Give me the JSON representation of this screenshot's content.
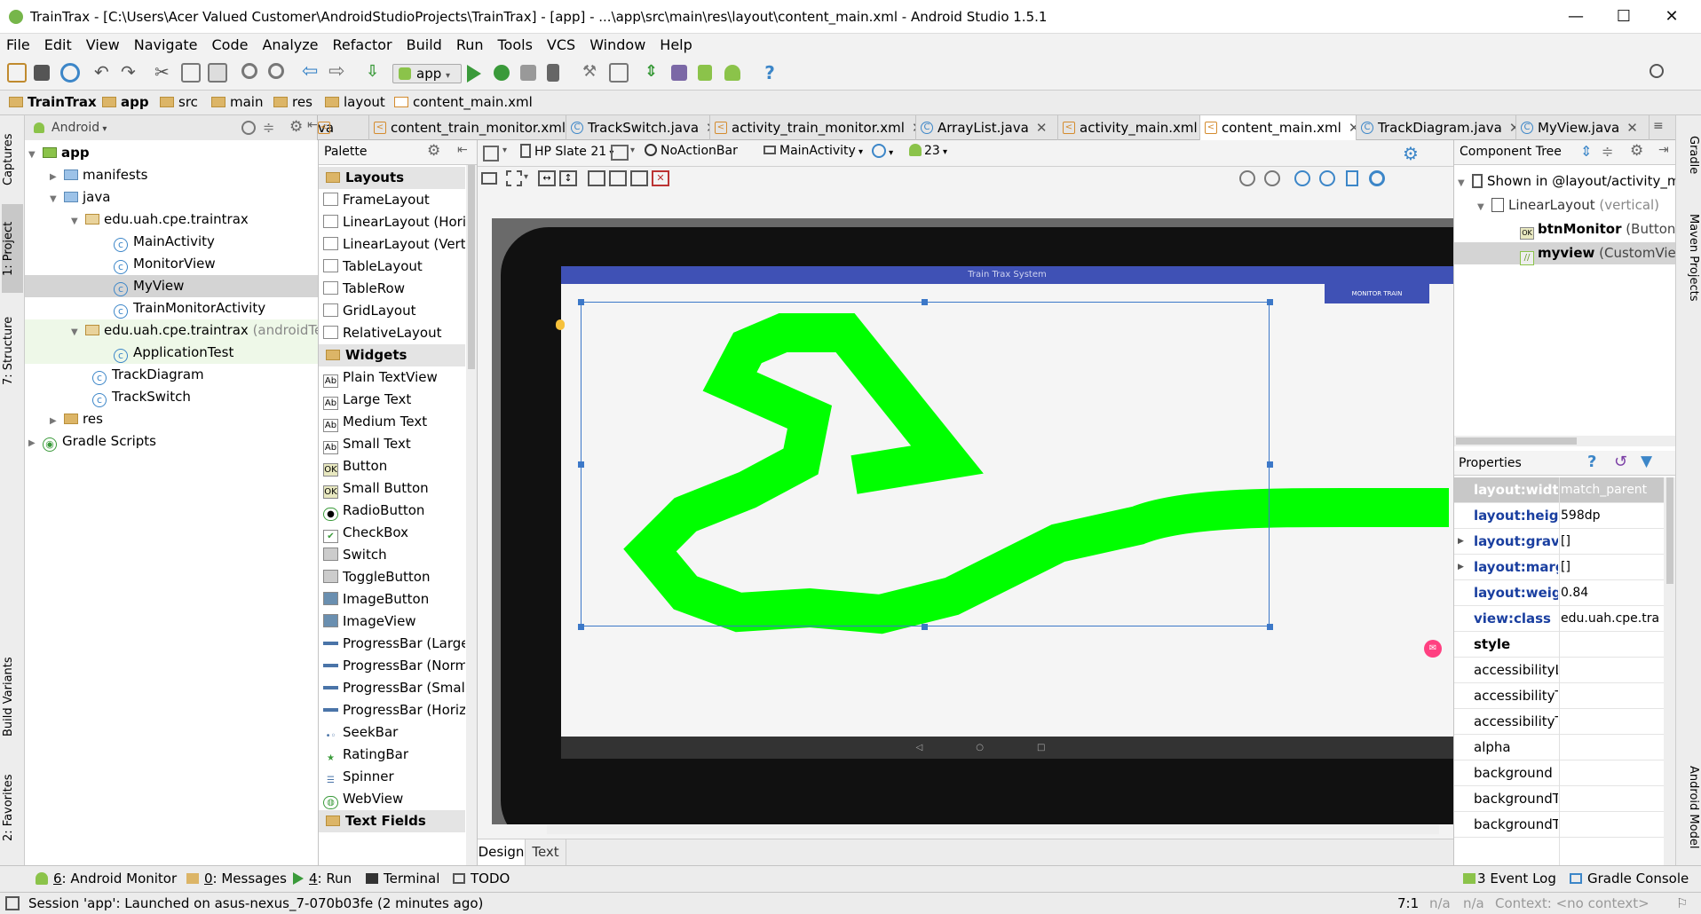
{
  "window": {
    "title": "TrainTrax - [C:\\Users\\Acer Valued Customer\\AndroidStudioProjects\\TrainTrax] - [app] - ...\\app\\src\\main\\res\\layout\\content_main.xml - Android Studio 1.5.1",
    "min": "—",
    "max": "☐",
    "close": "✕"
  },
  "menu": [
    "File",
    "Edit",
    "View",
    "Navigate",
    "Code",
    "Analyze",
    "Refactor",
    "Build",
    "Run",
    "Tools",
    "VCS",
    "Window",
    "Help"
  ],
  "toolbar": {
    "config": "app"
  },
  "nav": [
    "TrainTrax",
    "app",
    "src",
    "main",
    "res",
    "layout",
    "content_main.xml"
  ],
  "project_view": "Android",
  "tabs": [
    {
      "label": "va",
      "type": "xml"
    },
    {
      "label": "content_train_monitor.xml",
      "type": "xml"
    },
    {
      "label": "TrackSwitch.java",
      "type": "java"
    },
    {
      "label": "activity_train_monitor.xml",
      "type": "xml"
    },
    {
      "label": "ArrayList.java",
      "type": "java"
    },
    {
      "label": "activity_main.xml",
      "type": "xml"
    },
    {
      "label": "content_main.xml",
      "type": "xml"
    },
    {
      "label": "TrackDiagram.java",
      "type": "java"
    },
    {
      "label": "MyView.java",
      "type": "java"
    }
  ],
  "left_tabs": [
    "Captures",
    "1: Project",
    "7: Structure",
    "Build Variants",
    "2: Favorites"
  ],
  "tree": [
    {
      "label": "app",
      "level": 0,
      "kind": "module"
    },
    {
      "label": "manifests",
      "level": 1,
      "kind": "folder"
    },
    {
      "label": "java",
      "level": 1,
      "kind": "folder"
    },
    {
      "label": "edu.uah.cpe.traintrax",
      "level": 2,
      "kind": "package"
    },
    {
      "label": "MainActivity",
      "level": 3,
      "kind": "class"
    },
    {
      "label": "MonitorView",
      "level": 3,
      "kind": "class"
    },
    {
      "label": "MyView",
      "level": 3,
      "kind": "class"
    },
    {
      "label": "TrainMonitorActivity",
      "level": 3,
      "kind": "class"
    },
    {
      "label": "edu.uah.cpe.traintrax",
      "suffix": "(androidTest)",
      "level": 2,
      "kind": "package"
    },
    {
      "label": "ApplicationTest",
      "level": 3,
      "kind": "class"
    },
    {
      "label": "TrackDiagram",
      "level": 2,
      "kind": "class"
    },
    {
      "label": "TrackSwitch",
      "level": 2,
      "kind": "class"
    },
    {
      "label": "res",
      "level": 1,
      "kind": "folder"
    },
    {
      "label": "Gradle Scripts",
      "level": 0,
      "kind": "gradle"
    }
  ],
  "palette": {
    "title": "Palette",
    "groups": [
      {
        "name": "Layouts",
        "items": [
          "FrameLayout",
          "LinearLayout (Horiz",
          "LinearLayout (Verti",
          "TableLayout",
          "TableRow",
          "GridLayout",
          "RelativeLayout"
        ]
      },
      {
        "name": "Widgets",
        "items": [
          "Plain TextView",
          "Large Text",
          "Medium Text",
          "Small Text",
          "Button",
          "Small Button",
          "RadioButton",
          "CheckBox",
          "Switch",
          "ToggleButton",
          "ImageButton",
          "ImageView",
          "ProgressBar (Large",
          "ProgressBar (Norm",
          "ProgressBar (Small",
          "ProgressBar (Horiz",
          "SeekBar",
          "RatingBar",
          "Spinner",
          "WebView"
        ]
      },
      {
        "name": "Text Fields",
        "items": []
      }
    ]
  },
  "designer": {
    "device": "HP Slate 21",
    "theme": "NoActionBar",
    "activity": "MainActivity",
    "api": "23",
    "app_title": "Train Trax System",
    "button": "MONITOR TRAIN",
    "track_color": "#00ff00",
    "tabs": [
      "Design",
      "Text"
    ]
  },
  "component_tree": {
    "title": "Component Tree",
    "items": [
      {
        "label": "Shown in @layout/activity_main",
        "level": 0
      },
      {
        "label": "LinearLayout",
        "suffix": "(vertical)",
        "level": 1
      },
      {
        "label": "btnMonitor",
        "suffix": "(Button) - \"",
        "level": 2
      },
      {
        "label": "myview",
        "suffix": "(CustomView) -",
        "level": 2
      }
    ]
  },
  "properties": {
    "title": "Properties",
    "rows": [
      {
        "name": "layout:width",
        "value": "match_parent",
        "bold": true
      },
      {
        "name": "layout:height",
        "value": "598dp",
        "bold": true
      },
      {
        "name": "layout:gravity",
        "value": "[]",
        "bold": true
      },
      {
        "name": "layout:margin",
        "value": "[]",
        "bold": true
      },
      {
        "name": "layout:weight",
        "value": "0.84",
        "bold": true
      },
      {
        "name": "view:class",
        "value": "edu.uah.cpe.trai...",
        "bold": true
      },
      {
        "name": "style",
        "value": "",
        "bold": true
      },
      {
        "name": "accessibilityLiv",
        "value": "",
        "bold": false
      },
      {
        "name": "accessibilityTr",
        "value": "",
        "bold": false
      },
      {
        "name": "accessibilityTr",
        "value": "",
        "bold": false
      },
      {
        "name": "alpha",
        "value": "",
        "bold": false
      },
      {
        "name": "background",
        "value": "",
        "bold": false
      },
      {
        "name": "backgroundTi",
        "value": "",
        "bold": false
      },
      {
        "name": "backgroundTi",
        "value": "",
        "bold": false
      }
    ]
  },
  "right_tabs": [
    "Gradle",
    "Maven Projects",
    "Android Model"
  ],
  "bottom_tools": [
    {
      "num": "6",
      "label": ": Android Monitor"
    },
    {
      "num": "0",
      "label": ": Messages"
    },
    {
      "num": "4",
      "label": ": Run"
    },
    {
      "num": "",
      "label": "Terminal"
    },
    {
      "num": "",
      "label": "TODO"
    }
  ],
  "bottom_right": [
    "Event Log",
    "Gradle Console"
  ],
  "event_log_num": "3",
  "status": {
    "message": "Session 'app': Launched on asus-nexus_7-070b03fe (2 minutes ago)",
    "pos": "7:1",
    "na1": "n/a",
    "na2": "n/a",
    "context": "Context: <no context>"
  }
}
